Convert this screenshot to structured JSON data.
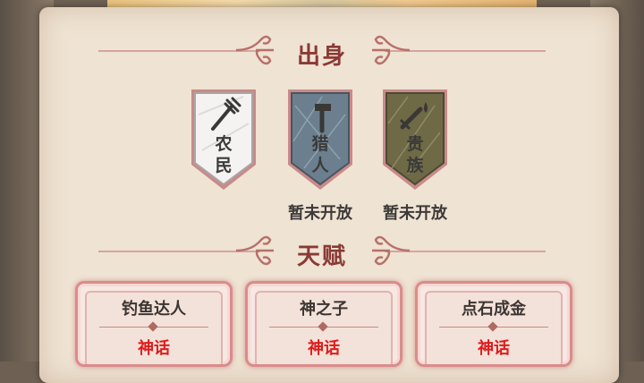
{
  "sections": {
    "origin_title": "出身",
    "talent_title": "天赋"
  },
  "origins": [
    {
      "name_line1": "农",
      "name_line2": "民",
      "icon": "pitchfork-icon",
      "status": "",
      "locked": false
    },
    {
      "name_line1": "猎",
      "name_line2": "人",
      "icon": "hammer-icon",
      "status": "暂未开放",
      "locked": true
    },
    {
      "name_line1": "贵",
      "name_line2": "族",
      "icon": "sword-blood-icon",
      "status": "暂未开放",
      "locked": true
    }
  ],
  "talents": [
    {
      "name": "钓鱼达人",
      "rarity": "神话"
    },
    {
      "name": "神之子",
      "rarity": "神话"
    },
    {
      "name": "点石成金",
      "rarity": "神话"
    }
  ],
  "colors": {
    "title": "#8a3a35",
    "mythic": "#e01b1b",
    "farmer_shield": "#f2f1f0",
    "hunter_shield": "#6b7f8e",
    "noble_shield": "#6e6a46"
  }
}
